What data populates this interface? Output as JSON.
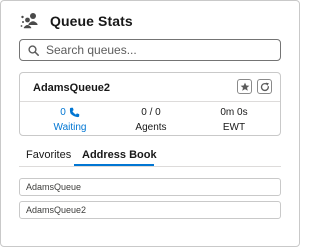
{
  "header": {
    "icon": "queue-people-icon",
    "title": "Queue Stats"
  },
  "search": {
    "icon": "search-icon",
    "placeholder": "Search queues..."
  },
  "queue_card": {
    "name": "AdamsQueue2",
    "favorite_icon": "star-icon",
    "refresh_icon": "refresh-icon",
    "stats": {
      "waiting": {
        "value": "0",
        "label": "Waiting",
        "icon": "phone-icon"
      },
      "agents": {
        "value": "0 / 0",
        "label": "Agents"
      },
      "ewt": {
        "value": "0m 0s",
        "label": "EWT"
      }
    }
  },
  "tabs": [
    {
      "label": "Favorites",
      "active": false
    },
    {
      "label": "Address Book",
      "active": true
    }
  ],
  "address_book": [
    {
      "label": "AdamsQueue"
    },
    {
      "label": "AdamsQueue2"
    }
  ],
  "colors": {
    "accent": "#0176d3",
    "border": "#c9c9c9",
    "text": "#181818"
  }
}
